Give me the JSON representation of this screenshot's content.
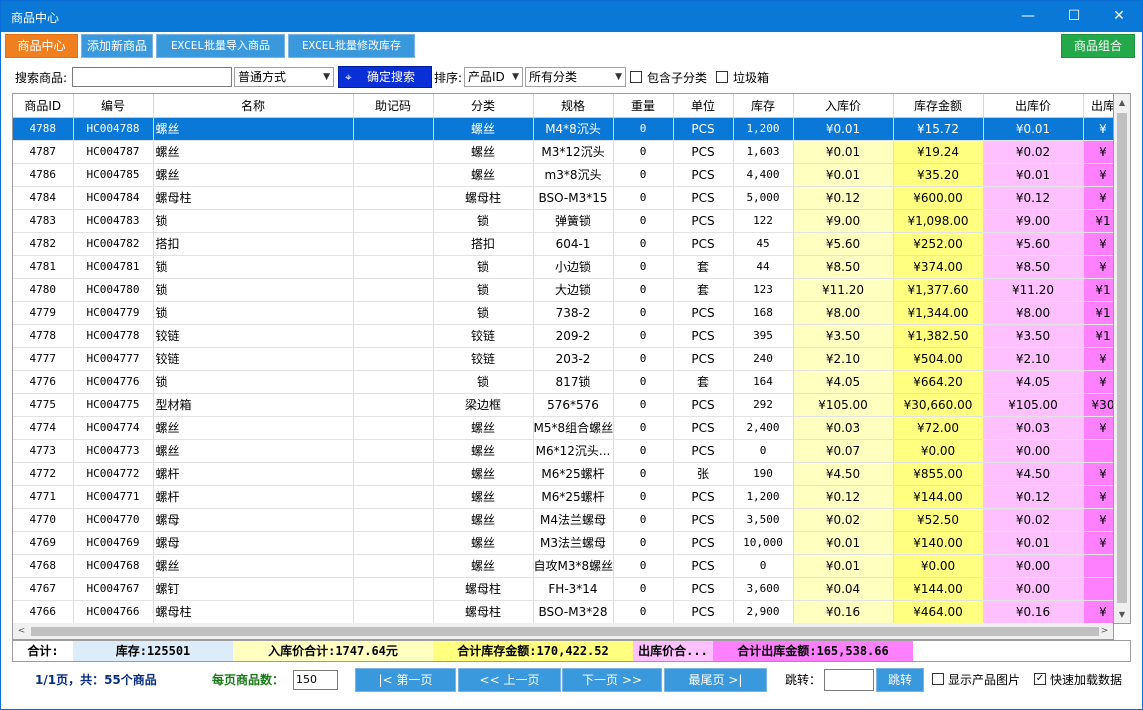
{
  "window": {
    "title": "商品中心",
    "controls": {
      "minimize": "—",
      "maximize": "☐",
      "close": "✕"
    }
  },
  "toolbar": {
    "tabs": [
      "商品中心",
      "添加新商品",
      "EXCEL批量导入商品",
      "EXCEL批量修改库存"
    ],
    "right_button": "商品组合"
  },
  "search": {
    "label": "搜索商品:",
    "value": "",
    "mode": "普通方式",
    "button": "确定搜索",
    "sort_label": "排序:",
    "sort_value": "产品ID",
    "category_value": "所有分类",
    "include_sub_label": "包含子分类",
    "include_sub_checked": false,
    "trash_label": "垃圾箱",
    "trash_checked": false
  },
  "grid": {
    "columns": [
      "商品ID",
      "编号",
      "名称",
      "助记码",
      "分类",
      "规格",
      "重量",
      "单位",
      "库存",
      "入库价",
      "库存金额",
      "出库价",
      "出库"
    ],
    "selected_row_index": 0,
    "rows": [
      [
        "4788",
        "HC004788",
        "螺丝",
        "",
        "螺丝",
        "M4*8沉头",
        "0",
        "PCS",
        "1,200",
        "¥0.01",
        "¥15.72",
        "¥0.01",
        "¥"
      ],
      [
        "4787",
        "HC004787",
        "螺丝",
        "",
        "螺丝",
        "M3*12沉头",
        "0",
        "PCS",
        "1,603",
        "¥0.01",
        "¥19.24",
        "¥0.02",
        "¥"
      ],
      [
        "4786",
        "HC004785",
        "螺丝",
        "",
        "螺丝",
        "m3*8沉头",
        "0",
        "PCS",
        "4,400",
        "¥0.01",
        "¥35.20",
        "¥0.01",
        "¥"
      ],
      [
        "4784",
        "HC004784",
        "螺母柱",
        "",
        "螺母柱",
        "BSO-M3*15",
        "0",
        "PCS",
        "5,000",
        "¥0.12",
        "¥600.00",
        "¥0.12",
        "¥"
      ],
      [
        "4783",
        "HC004783",
        "锁",
        "",
        "锁",
        "弹簧锁",
        "0",
        "PCS",
        "122",
        "¥9.00",
        "¥1,098.00",
        "¥9.00",
        "¥1"
      ],
      [
        "4782",
        "HC004782",
        "搭扣",
        "",
        "搭扣",
        "604-1",
        "0",
        "PCS",
        "45",
        "¥5.60",
        "¥252.00",
        "¥5.60",
        "¥"
      ],
      [
        "4781",
        "HC004781",
        "锁",
        "",
        "锁",
        "小边锁",
        "0",
        "套",
        "44",
        "¥8.50",
        "¥374.00",
        "¥8.50",
        "¥"
      ],
      [
        "4780",
        "HC004780",
        "锁",
        "",
        "锁",
        "大边锁",
        "0",
        "套",
        "123",
        "¥11.20",
        "¥1,377.60",
        "¥11.20",
        "¥1"
      ],
      [
        "4779",
        "HC004779",
        "锁",
        "",
        "锁",
        "738-2",
        "0",
        "PCS",
        "168",
        "¥8.00",
        "¥1,344.00",
        "¥8.00",
        "¥1"
      ],
      [
        "4778",
        "HC004778",
        "铰链",
        "",
        "铰链",
        "209-2",
        "0",
        "PCS",
        "395",
        "¥3.50",
        "¥1,382.50",
        "¥3.50",
        "¥1"
      ],
      [
        "4777",
        "HC004777",
        "铰链",
        "",
        "铰链",
        "203-2",
        "0",
        "PCS",
        "240",
        "¥2.10",
        "¥504.00",
        "¥2.10",
        "¥"
      ],
      [
        "4776",
        "HC004776",
        "锁",
        "",
        "锁",
        "817锁",
        "0",
        "套",
        "164",
        "¥4.05",
        "¥664.20",
        "¥4.05",
        "¥"
      ],
      [
        "4775",
        "HC004775",
        "型材箱",
        "",
        "梁边框",
        "576*576",
        "0",
        "PCS",
        "292",
        "¥105.00",
        "¥30,660.00",
        "¥105.00",
        "¥30"
      ],
      [
        "4774",
        "HC004774",
        "螺丝",
        "",
        "螺丝",
        "M5*8组合螺丝",
        "0",
        "PCS",
        "2,400",
        "¥0.03",
        "¥72.00",
        "¥0.03",
        "¥"
      ],
      [
        "4773",
        "HC004773",
        "螺丝",
        "",
        "螺丝",
        "M6*12沉头...",
        "0",
        "PCS",
        "0",
        "¥0.07",
        "¥0.00",
        "¥0.00",
        ""
      ],
      [
        "4772",
        "HC004772",
        "螺杆",
        "",
        "螺丝",
        "M6*25螺杆",
        "0",
        "张",
        "190",
        "¥4.50",
        "¥855.00",
        "¥4.50",
        "¥"
      ],
      [
        "4771",
        "HC004771",
        "螺杆",
        "",
        "螺丝",
        "M6*25螺杆",
        "0",
        "PCS",
        "1,200",
        "¥0.12",
        "¥144.00",
        "¥0.12",
        "¥"
      ],
      [
        "4770",
        "HC004770",
        "螺母",
        "",
        "螺丝",
        "M4法兰螺母",
        "0",
        "PCS",
        "3,500",
        "¥0.02",
        "¥52.50",
        "¥0.02",
        "¥"
      ],
      [
        "4769",
        "HC004769",
        "螺母",
        "",
        "螺丝",
        "M3法兰螺母",
        "0",
        "PCS",
        "10,000",
        "¥0.01",
        "¥140.00",
        "¥0.01",
        "¥"
      ],
      [
        "4768",
        "HC004768",
        "螺丝",
        "",
        "螺丝",
        "自攻M3*8螺丝",
        "0",
        "PCS",
        "0",
        "¥0.01",
        "¥0.00",
        "¥0.00",
        ""
      ],
      [
        "4767",
        "HC004767",
        "螺钉",
        "",
        "螺母柱",
        "FH-3*14",
        "0",
        "PCS",
        "3,600",
        "¥0.04",
        "¥144.00",
        "¥0.00",
        ""
      ],
      [
        "4766",
        "HC004766",
        "螺母柱",
        "",
        "螺母柱",
        "BSO-M3*28",
        "0",
        "PCS",
        "2,900",
        "¥0.16",
        "¥464.00",
        "¥0.16",
        "¥"
      ]
    ]
  },
  "totals": {
    "label": "合计:",
    "stock": "库存:125501",
    "in_price_sum": "入库价合计:1747.64元",
    "stock_amount_sum": "合计库存金额:170,422.52",
    "out_price_sum": "出库价合...",
    "out_amount_sum": "合计出库金额:165,538.66"
  },
  "footer": {
    "page_info": "1/1页，共：55个商品",
    "per_page_label": "每页商品数：",
    "per_page_value": "150",
    "first": "|< 第一页",
    "prev": "<< 上一页",
    "next": "下一页 >>",
    "last": "最尾页 >|",
    "jump_label": "跳转：",
    "jump_value": "",
    "jump_button": "跳转",
    "show_images_label": "显示产品图片",
    "show_images_checked": false,
    "fast_load_label": "快速加载数据",
    "fast_load_checked": true
  },
  "colors": {
    "title_bar": "#0978d6",
    "active_tab": "#ef7f1f",
    "tab": "#3a98dc",
    "combo_button": "#23a84a",
    "search_button": "#0a2fd6",
    "selected_row": "#0a78d7",
    "in_price_bg": "#ffffc0",
    "stock_amount_bg": "#ffff80",
    "out_price_bg": "#ffc0ff",
    "out_amount_bg": "#ff80ff"
  },
  "icons": {
    "search_button_icon": "binoculars-icon"
  }
}
